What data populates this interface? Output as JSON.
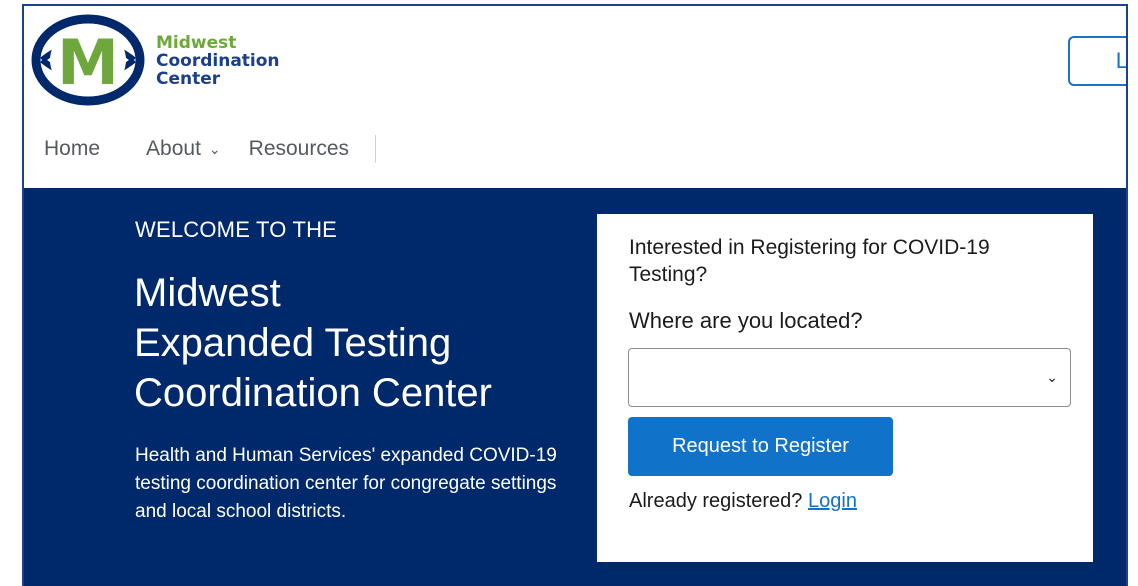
{
  "header": {
    "logo": {
      "line1": "Midwest",
      "line2": "Coordination",
      "line3": "Center",
      "letter": "M"
    },
    "login_button": "Lo",
    "nav": {
      "home": "Home",
      "about": "About",
      "resources": "Resources"
    }
  },
  "hero": {
    "welcome": "WELCOME TO THE",
    "title_l1": "Midwest",
    "title_l2": "Expanded Testing",
    "title_l3": "Coordination Center",
    "description": "Health and Human Services' expanded COVID-19 testing coordination center for congregate settings and local school districts."
  },
  "card": {
    "question": "Interested in Registering for COVID-19 Testing?",
    "location_label": "Where are you located?",
    "location_select_value": "",
    "register_button": "Request to Register",
    "already_text": "Already registered?",
    "login_link": "Login"
  },
  "colors": {
    "navy": "#00296b",
    "brand_green": "#6ea83c",
    "brand_blue": "#1c3f8c",
    "button_blue": "#1172c9"
  }
}
